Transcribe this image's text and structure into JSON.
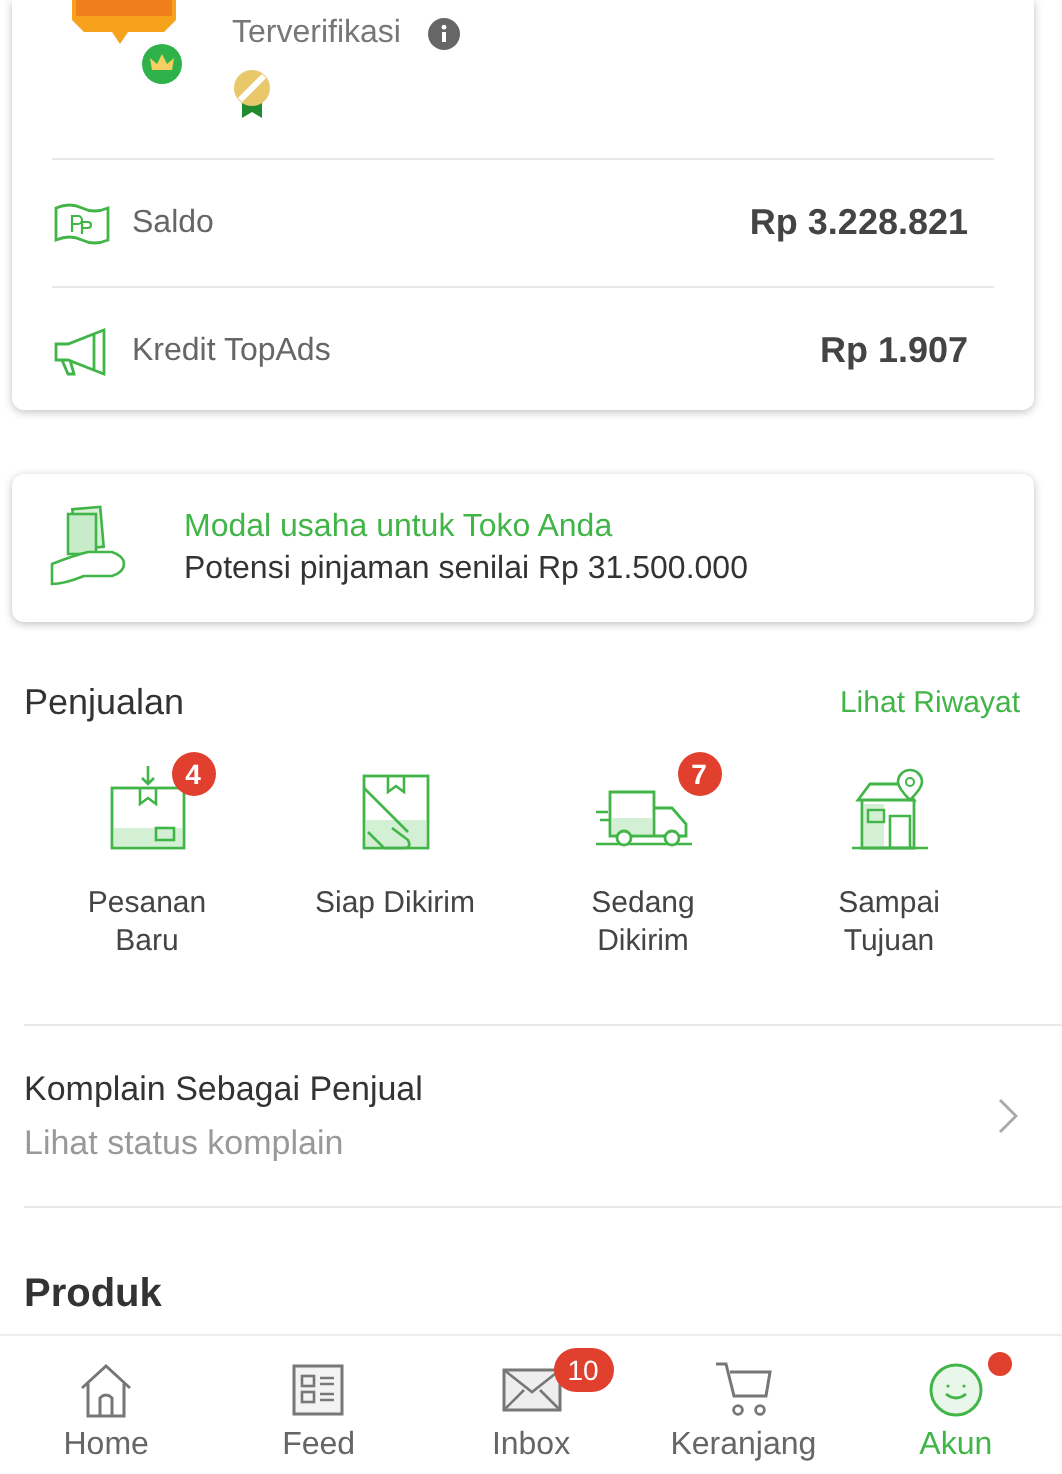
{
  "profile": {
    "status": "Terverifikasi"
  },
  "balances": [
    {
      "kind": "saldo",
      "label": "Saldo",
      "amount": "Rp 3.228.821"
    },
    {
      "kind": "topads",
      "label": "Kredit TopAds",
      "amount": "Rp 1.907"
    }
  ],
  "loan": {
    "title": "Modal usaha untuk Toko Anda",
    "subtitle": "Potensi pinjaman senilai Rp 31.500.000"
  },
  "sales": {
    "title": "Penjualan",
    "link": "Lihat Riwayat",
    "items": [
      {
        "kind": "new",
        "label": "Pesanan Baru",
        "badge": "4"
      },
      {
        "kind": "ready",
        "label": "Siap Dikirim"
      },
      {
        "kind": "shipping",
        "label": "Sedang Dikirim",
        "badge": "7"
      },
      {
        "kind": "arrived",
        "label": "Sampai Tujuan"
      }
    ]
  },
  "complaint": {
    "title": "Komplain Sebagai Penjual",
    "subtitle": "Lihat status komplain"
  },
  "products": {
    "title": "Produk"
  },
  "nav": [
    {
      "kind": "home",
      "label": "Home",
      "selected": false
    },
    {
      "kind": "feed",
      "label": "Feed",
      "selected": false
    },
    {
      "kind": "inbox",
      "label": "Inbox",
      "selected": false,
      "badge": "10"
    },
    {
      "kind": "cart",
      "label": "Keranjang",
      "selected": false
    },
    {
      "kind": "account",
      "label": "Akun",
      "selected": true,
      "dot": true
    }
  ]
}
